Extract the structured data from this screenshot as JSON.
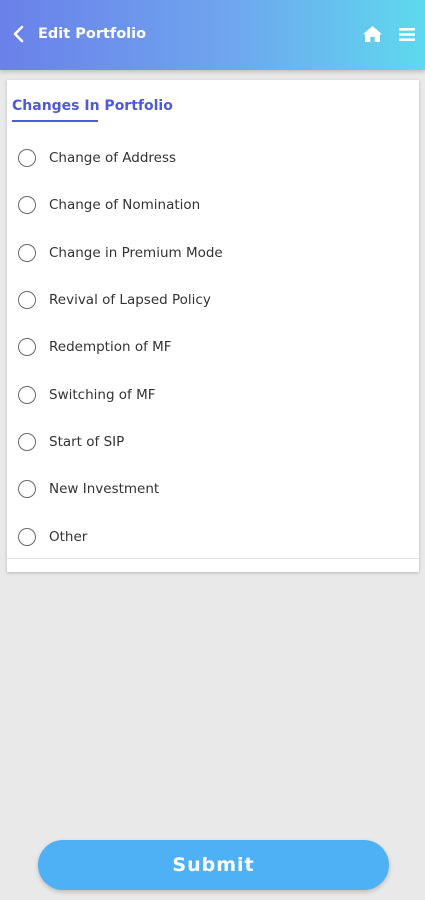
{
  "header": {
    "title": "Edit Portfolio",
    "back_icon": "chevron-left-icon",
    "home_icon": "home-icon",
    "menu_icon": "hamburger-menu-icon"
  },
  "section": {
    "title": "Changes In Portfolio"
  },
  "options": [
    {
      "label": "Change of Address",
      "selected": false
    },
    {
      "label": "Change of Nomination",
      "selected": false
    },
    {
      "label": "Change in Premium Mode",
      "selected": false
    },
    {
      "label": "Revival of Lapsed Policy",
      "selected": false
    },
    {
      "label": "Redemption of MF",
      "selected": false
    },
    {
      "label": "Switching of MF",
      "selected": false
    },
    {
      "label": "Start of SIP",
      "selected": false
    },
    {
      "label": "New Investment",
      "selected": false
    },
    {
      "label": "Other",
      "selected": false
    }
  ],
  "submit": {
    "label": "Submit"
  },
  "colors": {
    "header_gradient_start": "#6a80ea",
    "header_gradient_end": "#5ed9ee",
    "accent": "#4f5ad6",
    "submit_button": "#4fb1f5",
    "background": "#e9e9e9"
  }
}
